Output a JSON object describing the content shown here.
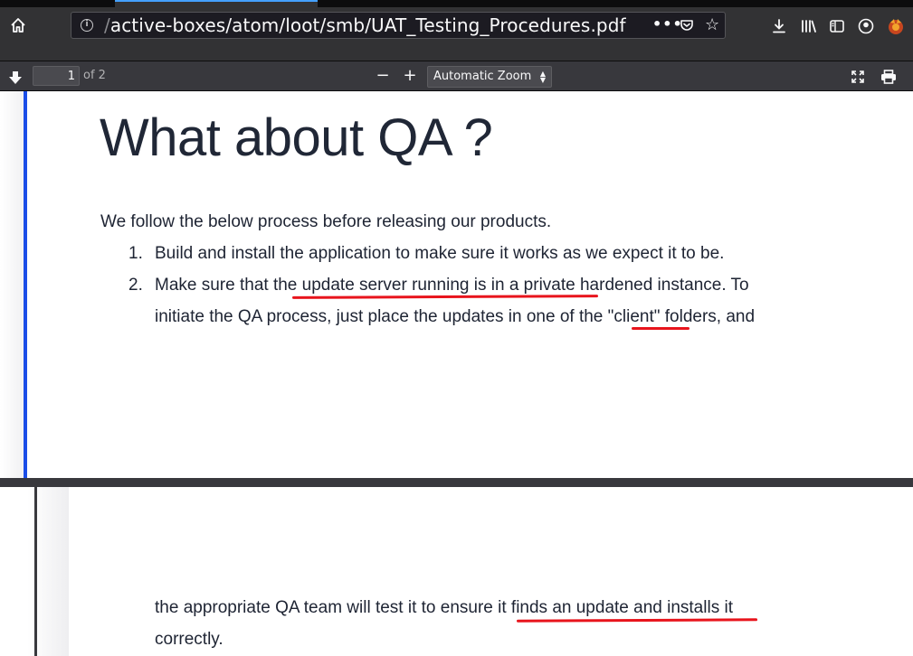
{
  "browser": {
    "url_prefix": "/",
    "url_path": "active-boxes/atom/loot/smb/UAT_Testing_Procedures.pdf",
    "page_actions_label": "•••"
  },
  "pdf_toolbar": {
    "page_number": "1",
    "page_count_label": "of 2",
    "zoom_out_label": "−",
    "zoom_in_label": "+",
    "zoom_value": "Automatic Zoom"
  },
  "document": {
    "heading": "What about QA ?",
    "intro": "We follow the below process before releasing our products.",
    "list": [
      {
        "number": "1.",
        "lines": [
          "Build and install the application to make sure it works as we expect it to be."
        ]
      },
      {
        "number": "2.",
        "lines": [
          "Make sure that the update server running is in a private hardened instance. To",
          "initiate the QA process, just place the updates in one of the \"client\" folders, and",
          "the appropriate QA team will test it to ensure it finds an update and installs it",
          "correctly."
        ]
      }
    ]
  },
  "annotations": {
    "underline_color": "#e8141c",
    "underlined_phrases": [
      "update server running is in a private",
      "\"client\"",
      "it finds an update and installs it"
    ]
  },
  "colors": {
    "toolbar_bg": "#38383d",
    "urlbar_bg": "#1c1b22",
    "accent_blue": "#1a4de8"
  }
}
